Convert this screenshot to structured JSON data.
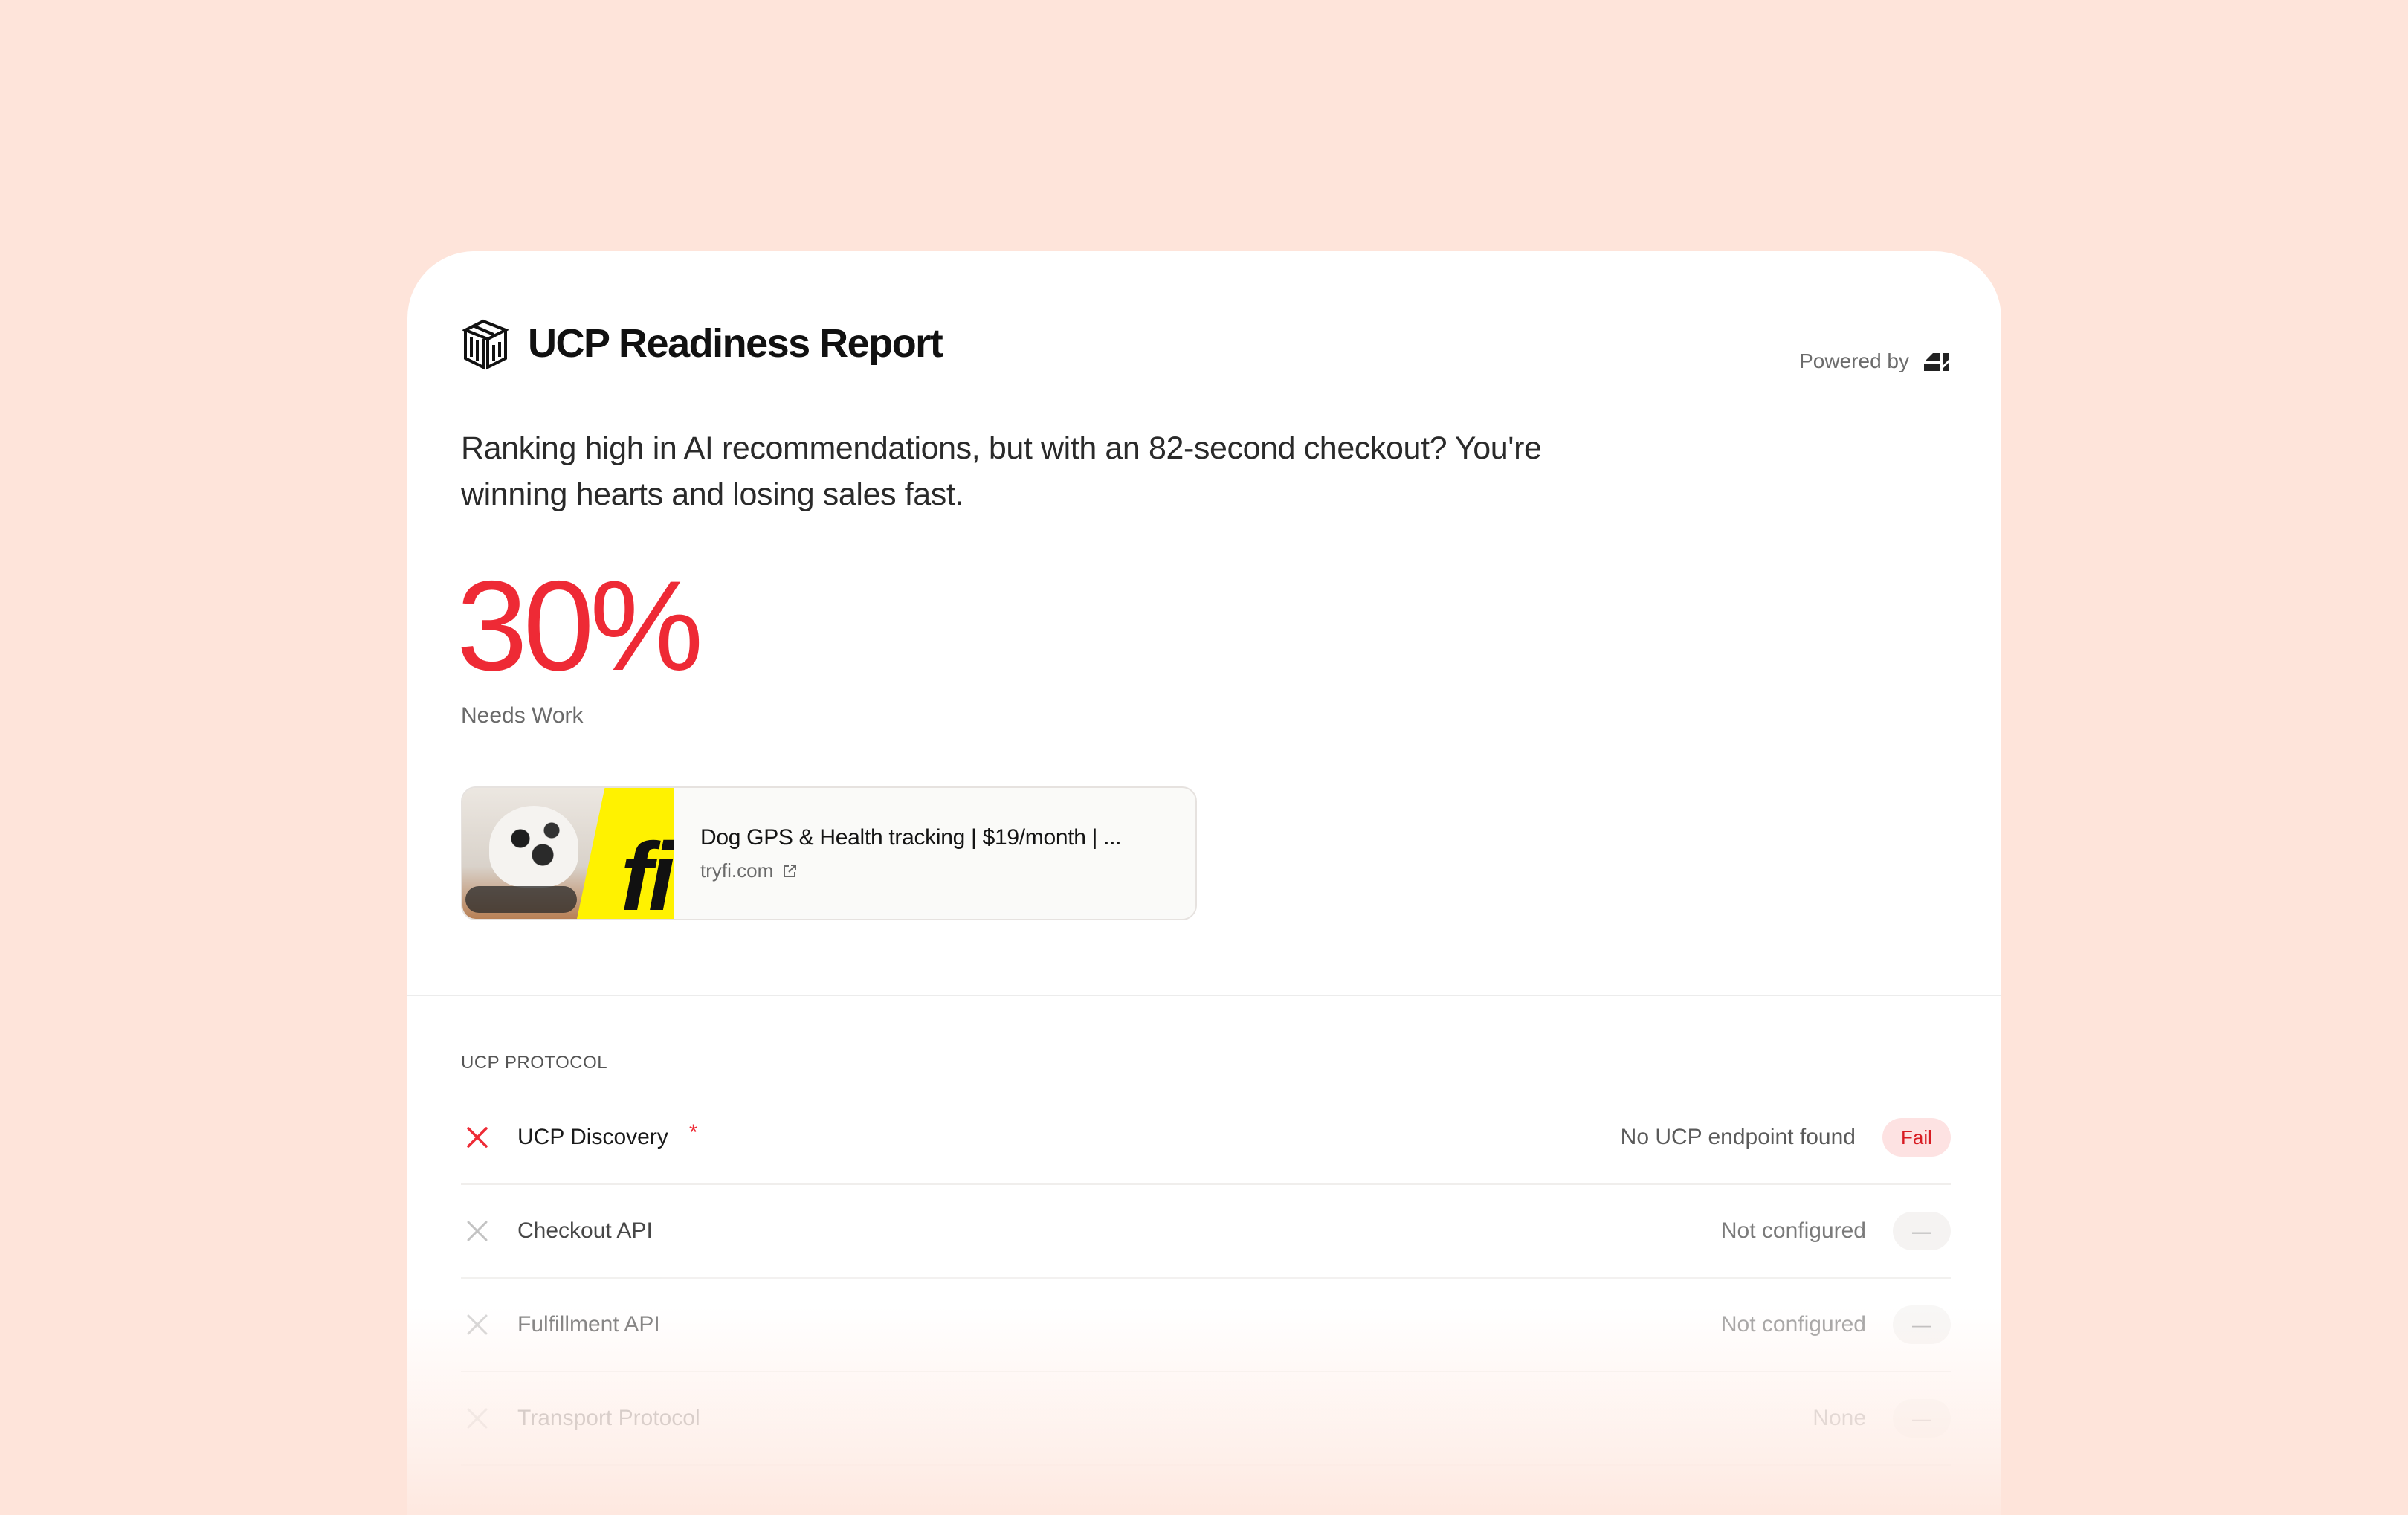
{
  "colors": {
    "background": "#FEE4DA",
    "accent_red": "#EE2A35",
    "fail_pill_bg": "#FDE2E2",
    "fail_pill_text": "#D81B22"
  },
  "header": {
    "logo_icon": "ucp-cube-logo-icon",
    "title": "UCP Readiness Report",
    "powered_by_label": "Powered by",
    "powered_by_logo": "brand-logo-icon"
  },
  "summary": {
    "headline": "Ranking high in AI recommendations, but with an 82-second checkout? You're winning hearts and losing sales fast.",
    "score": "30%",
    "score_value": 30,
    "score_label": "Needs Work"
  },
  "site": {
    "title": "Dog GPS & Health tracking | $19/month | ...",
    "url": "tryfi.com",
    "thumbnail_text": "fi",
    "external_icon": "external-link-icon"
  },
  "protocol": {
    "section_label": "UCP PROTOCOL",
    "rows": [
      {
        "name": "UCP Discovery",
        "required": "*",
        "status": "No UCP endpoint found",
        "pill": "Fail",
        "icon": "x-icon"
      },
      {
        "name": "Checkout API",
        "required": "",
        "status": "Not configured",
        "pill": "—",
        "icon": "x-icon"
      },
      {
        "name": "Fulfillment API",
        "required": "",
        "status": "Not configured",
        "pill": "—",
        "icon": "x-icon"
      },
      {
        "name": "Transport Protocol",
        "required": "",
        "status": "None",
        "pill": "—",
        "icon": "x-icon"
      }
    ]
  }
}
